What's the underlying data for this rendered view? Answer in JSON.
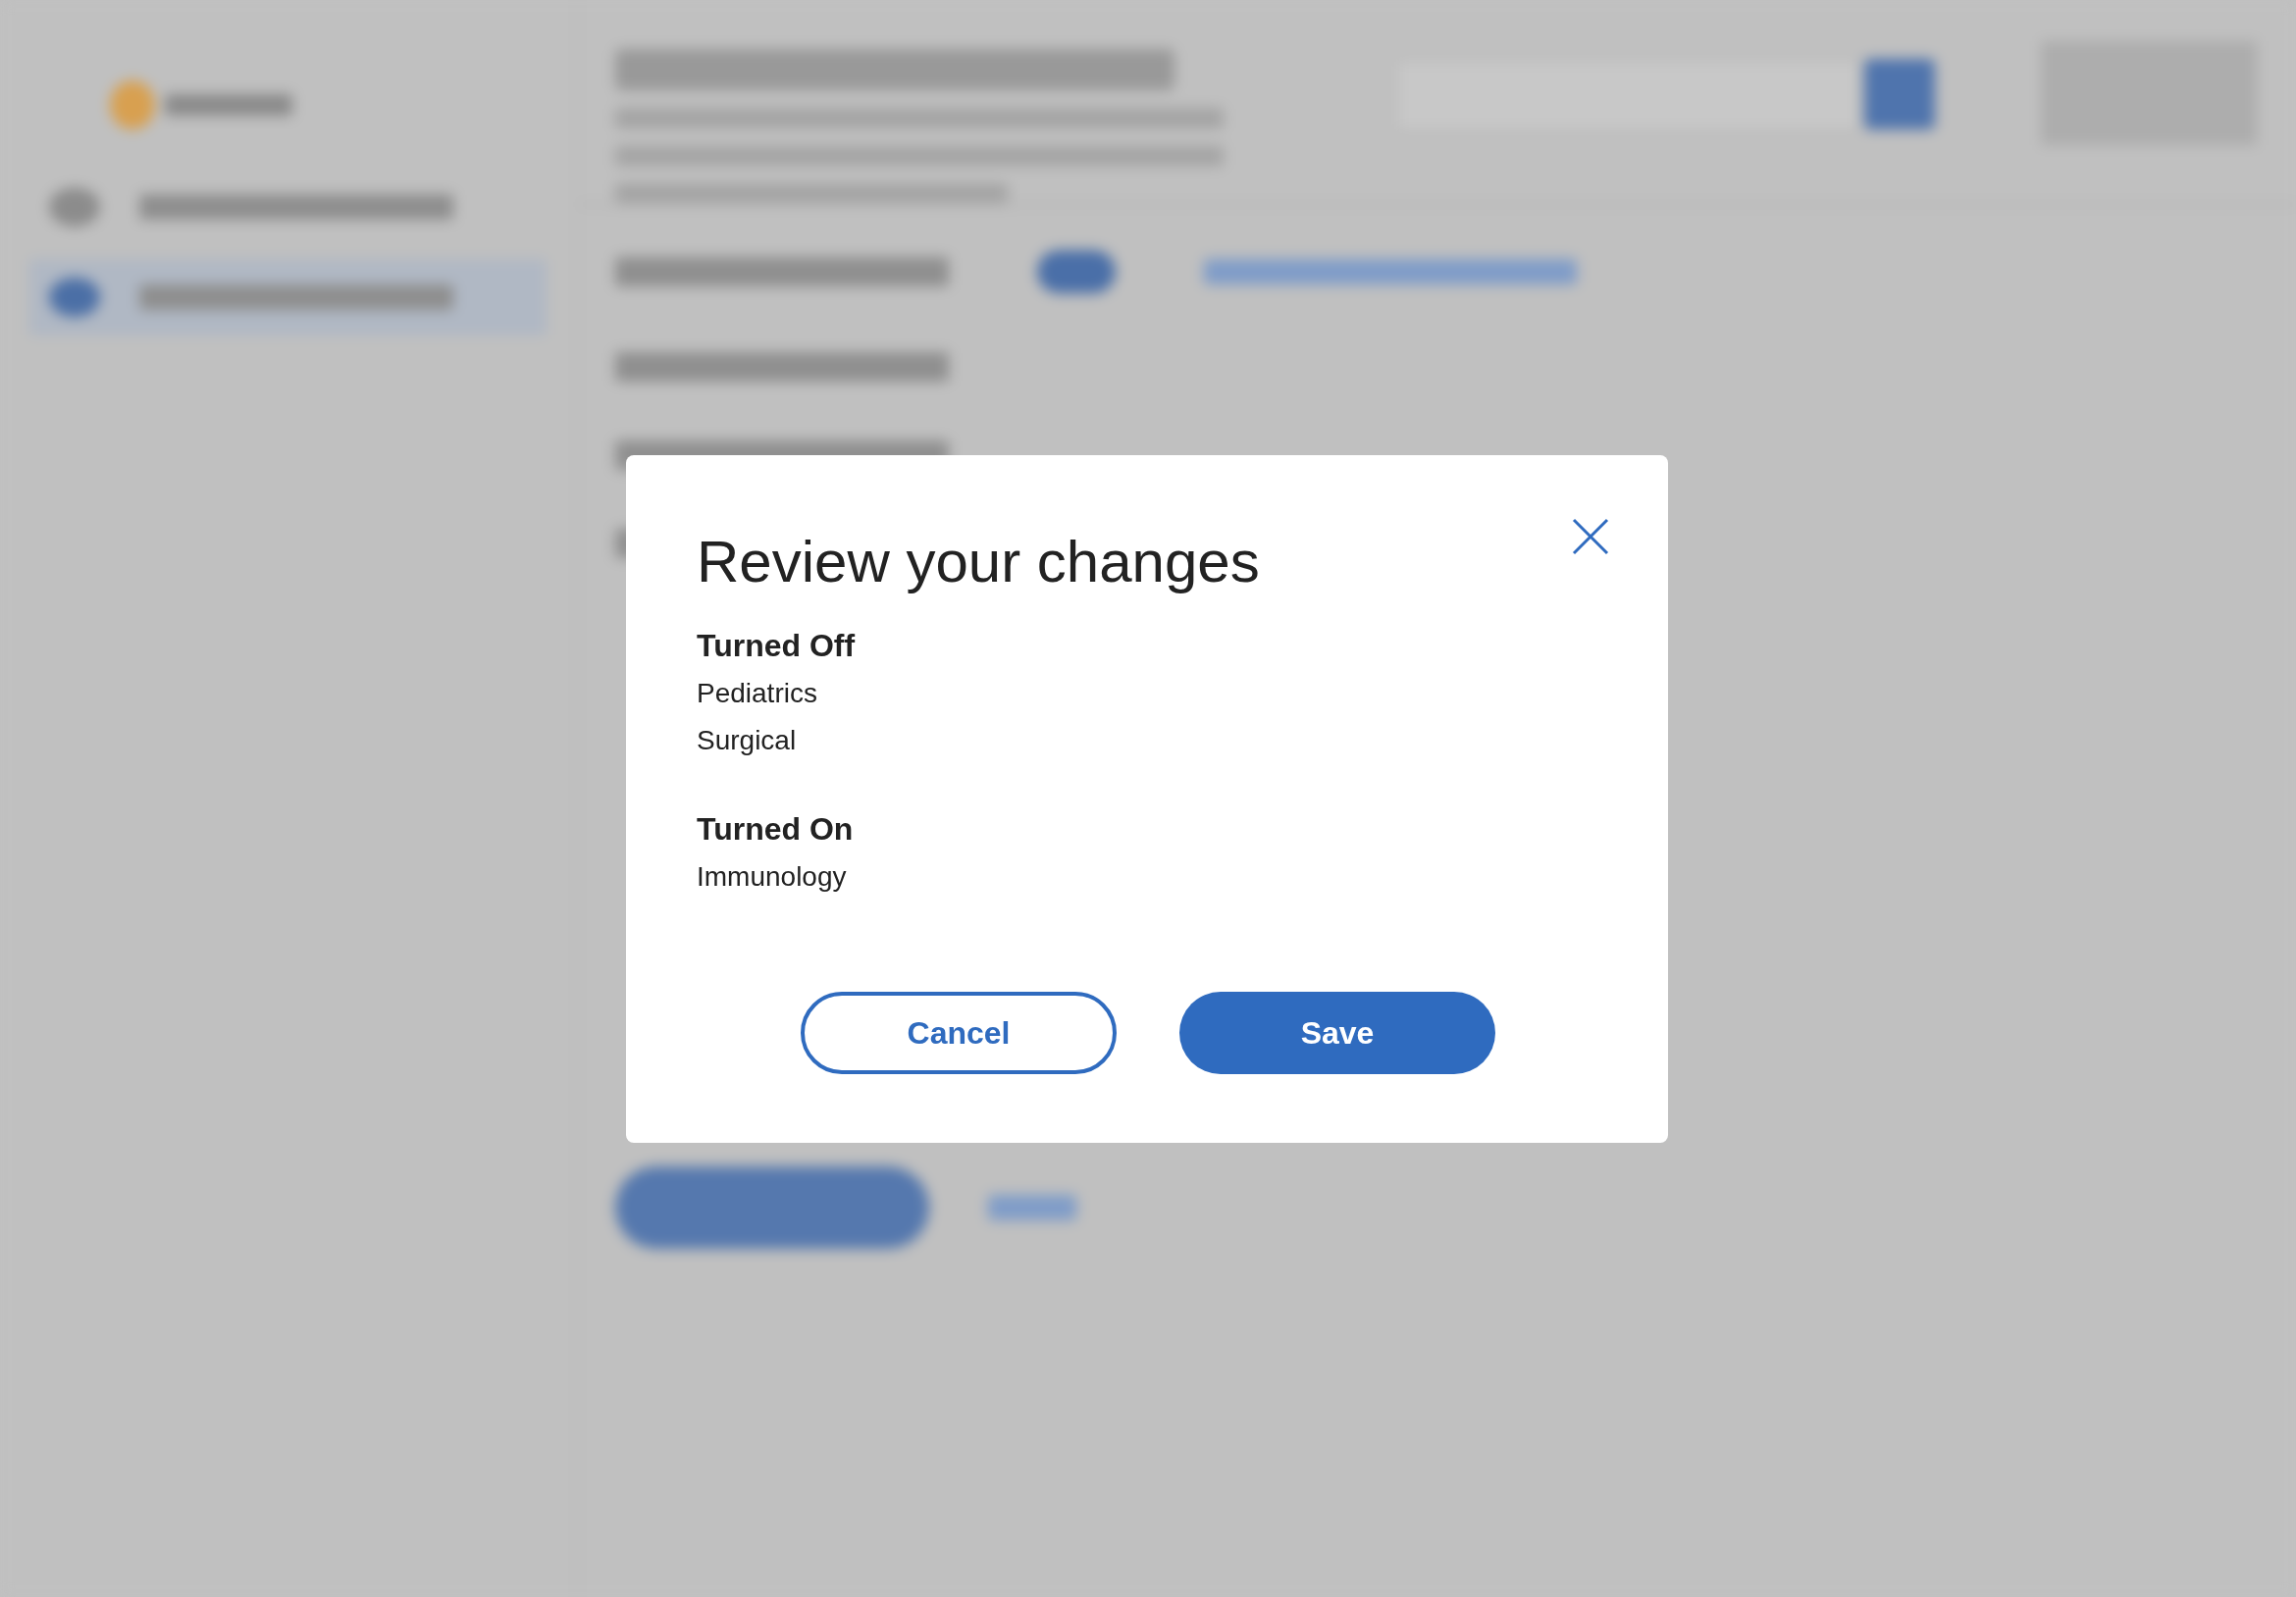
{
  "dialog": {
    "title": "Review your changes",
    "sections": [
      {
        "heading": "Turned Off",
        "items": [
          "Pediatrics",
          "Surgical"
        ]
      },
      {
        "heading": "Turned On",
        "items": [
          "Immunology"
        ]
      }
    ],
    "buttons": [
      {
        "label": "Cancel",
        "kind": "secondary"
      },
      {
        "label": "Save",
        "kind": "primary"
      }
    ]
  }
}
